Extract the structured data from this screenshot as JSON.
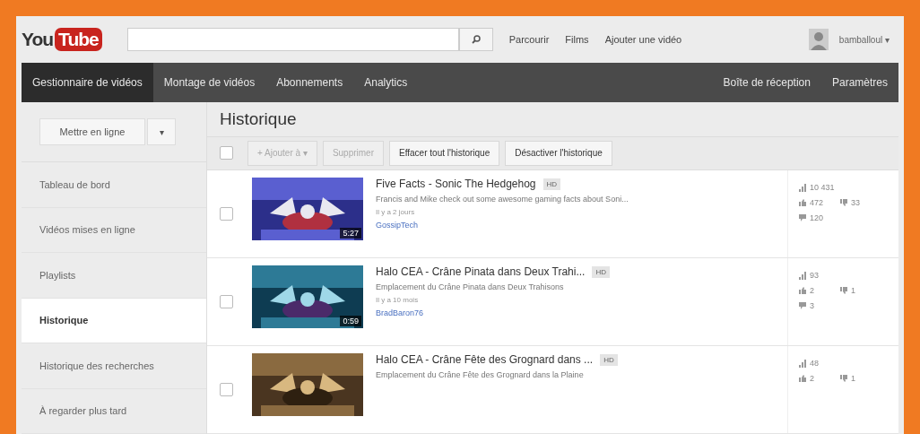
{
  "header": {
    "logo": {
      "left": "You",
      "right": "Tube"
    },
    "links": [
      "Parcourir",
      "Films",
      "Ajouter une vidéo"
    ],
    "user": "bamballoul ▾"
  },
  "nav": {
    "left": [
      {
        "label": "Gestionnaire de vidéos",
        "selected": true
      },
      {
        "label": "Montage de vidéos",
        "selected": false
      },
      {
        "label": "Abonnements",
        "selected": false
      },
      {
        "label": "Analytics",
        "selected": false
      }
    ],
    "right": [
      {
        "label": "Boîte de réception",
        "selected": false
      },
      {
        "label": "Paramètres",
        "selected": false
      }
    ]
  },
  "sidebar": {
    "upload": "Mettre en ligne",
    "upload_menu": "▾",
    "items": [
      {
        "label": "Tableau de bord",
        "selected": false
      },
      {
        "label": "Vidéos mises en ligne",
        "selected": false
      },
      {
        "label": "Playlists",
        "selected": false
      },
      {
        "label": "Historique",
        "selected": true
      },
      {
        "label": "Historique des recherches",
        "selected": false
      },
      {
        "label": "À regarder plus tard",
        "selected": false
      }
    ]
  },
  "main": {
    "title": "Historique",
    "select_all": {
      "checked": false
    },
    "actions": [
      {
        "label": "+ Ajouter à ▾",
        "disabled": true
      },
      {
        "label": "Supprimer",
        "disabled": true
      },
      {
        "label": "Effacer tout l'historique",
        "disabled": false
      },
      {
        "label": "Désactiver l'historique",
        "disabled": false
      }
    ],
    "videos": [
      {
        "checked": false,
        "duration": "5:27",
        "title": "Five Facts - Sonic The Hedgehog",
        "badge": "HD",
        "description": "Francis and Mike check out some awesome gaming facts about Soni...",
        "age": "Il y a 2 jours",
        "channel": "GossipTech",
        "views": "10 431",
        "likes": "472",
        "dislikes": "33",
        "comments": "120"
      },
      {
        "checked": false,
        "duration": "0:59",
        "title": "Halo CEA - Crâne Pinata dans Deux Trahi...",
        "badge": "HD",
        "description": "Emplacement du Crâne Pinata dans Deux Trahisons",
        "age": "Il y a 10 mois",
        "channel": "BradBaron76",
        "views": "93",
        "likes": "2",
        "dislikes": "1",
        "comments": "3"
      },
      {
        "checked": false,
        "title": "Halo CEA - Crâne Fête des Grognard dans ...",
        "badge": "HD",
        "description": "Emplacement du Crâne Fête des Grognard dans la Plaine",
        "views": "48",
        "likes": "2",
        "dislikes": "1"
      }
    ]
  }
}
